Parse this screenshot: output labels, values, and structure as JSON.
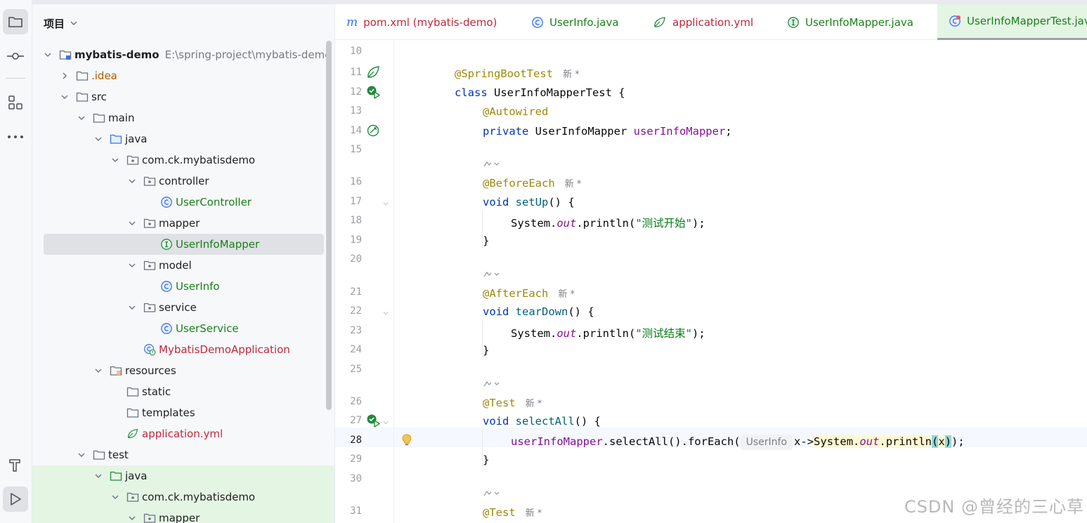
{
  "project_panel": {
    "title": "项目",
    "tree": [
      {
        "label": "mybatis-demo",
        "path": "E:\\spring-project\\mybatis-demo",
        "icon": "module-folder-icon",
        "indent": 0,
        "arrow": "down",
        "style": "bold"
      },
      {
        "label": ".idea",
        "icon": "folder-icon",
        "indent": 1,
        "arrow": "right",
        "style": "orange"
      },
      {
        "label": "src",
        "icon": "folder-icon",
        "indent": 1,
        "arrow": "down",
        "style": "normal"
      },
      {
        "label": "main",
        "icon": "folder-icon",
        "indent": 2,
        "arrow": "down",
        "style": "normal"
      },
      {
        "label": "java",
        "icon": "source-folder-icon",
        "indent": 3,
        "arrow": "down",
        "style": "normal"
      },
      {
        "label": "com.ck.mybatisdemo",
        "icon": "package-icon",
        "indent": 4,
        "arrow": "down",
        "style": "normal"
      },
      {
        "label": "controller",
        "icon": "package-icon",
        "indent": 5,
        "arrow": "down",
        "style": "normal"
      },
      {
        "label": "UserController",
        "icon": "class-icon",
        "indent": 6,
        "arrow": "none",
        "style": "green"
      },
      {
        "label": "mapper",
        "icon": "package-icon",
        "indent": 5,
        "arrow": "down",
        "style": "normal"
      },
      {
        "label": "UserInfoMapper",
        "icon": "interface-icon",
        "indent": 6,
        "arrow": "none",
        "style": "green",
        "selected": true
      },
      {
        "label": "model",
        "icon": "package-icon",
        "indent": 5,
        "arrow": "down",
        "style": "normal"
      },
      {
        "label": "UserInfo",
        "icon": "class-icon",
        "indent": 6,
        "arrow": "none",
        "style": "green"
      },
      {
        "label": "service",
        "icon": "package-icon",
        "indent": 5,
        "arrow": "down",
        "style": "normal"
      },
      {
        "label": "UserService",
        "icon": "class-icon",
        "indent": 6,
        "arrow": "none",
        "style": "green"
      },
      {
        "label": "MybatisDemoApplication",
        "icon": "spring-boot-class-icon",
        "indent": 5,
        "arrow": "none",
        "style": "red"
      },
      {
        "label": "resources",
        "icon": "resources-folder-icon",
        "indent": 3,
        "arrow": "down",
        "style": "normal"
      },
      {
        "label": "static",
        "icon": "folder-icon",
        "indent": 4,
        "arrow": "none",
        "style": "normal"
      },
      {
        "label": "templates",
        "icon": "folder-icon",
        "indent": 4,
        "arrow": "none",
        "style": "normal"
      },
      {
        "label": "application.yml",
        "icon": "spring-yaml-icon",
        "indent": 4,
        "arrow": "none",
        "style": "red"
      },
      {
        "label": "test",
        "icon": "folder-icon",
        "indent": 2,
        "arrow": "down",
        "style": "normal"
      },
      {
        "label": "java",
        "icon": "test-source-folder-icon",
        "indent": 3,
        "arrow": "down",
        "style": "normal",
        "green": true
      },
      {
        "label": "com.ck.mybatisdemo",
        "icon": "package-icon",
        "indent": 4,
        "arrow": "down",
        "style": "normal",
        "green": true
      },
      {
        "label": "mapper",
        "icon": "package-icon",
        "indent": 5,
        "arrow": "down",
        "style": "normal",
        "green": true
      }
    ]
  },
  "tabs": [
    {
      "label": "pom.xml (mybatis-demo)",
      "icon": "maven-icon",
      "color": "red"
    },
    {
      "label": "UserInfo.java",
      "icon": "class-icon",
      "color": "green"
    },
    {
      "label": "application.yml",
      "icon": "spring-yaml-icon",
      "color": "red"
    },
    {
      "label": "UserInfoMapper.java",
      "icon": "interface-icon",
      "color": "green"
    },
    {
      "label": "UserInfoMapperTest.java",
      "icon": "test-class-icon",
      "color": "green",
      "active": true
    }
  ],
  "editor": {
    "current_line": "28",
    "inlay_hint": "UserInfo",
    "author_mark": "新 *",
    "lines": [
      {
        "n": "10"
      },
      {
        "n": "11",
        "g": "spring-bean-icon"
      },
      {
        "n": "12",
        "g": "run-test-icon"
      },
      {
        "n": "13"
      },
      {
        "n": "14",
        "g": "spring-autowire-icon"
      },
      {
        "n": "15"
      },
      {
        "n": "16"
      },
      {
        "n": "17",
        "fold": true
      },
      {
        "n": "18"
      },
      {
        "n": "19"
      },
      {
        "n": "20"
      },
      {
        "n": "21"
      },
      {
        "n": "22",
        "fold": true
      },
      {
        "n": "23"
      },
      {
        "n": "24"
      },
      {
        "n": "25"
      },
      {
        "n": "26"
      },
      {
        "n": "27",
        "g": "run-test-icon",
        "fold": true
      },
      {
        "n": "28",
        "g": "lightbulb-icon"
      },
      {
        "n": "29"
      },
      {
        "n": "30"
      },
      {
        "n": "31"
      }
    ],
    "code": {
      "l11": "@SpringBootTest",
      "l12_kw": "class",
      "l12_rest": " UserInfoMapperTest {",
      "l13": "@Autowired",
      "l14_kw": "private",
      "l14_type": " UserInfoMapper ",
      "l14_field": "userInfoMapper",
      "l14_end": ";",
      "l16": "@BeforeEach",
      "l17_kw": "void",
      "l17_fn": "setUp",
      "l17_end": "() {",
      "l18_a": "System.",
      "l18_out": "out",
      "l18_b": ".println(",
      "l18_str": "\"测试开始\"",
      "l18_c": ");",
      "l19": "}",
      "l21": "@AfterEach",
      "l22_kw": "void",
      "l22_fn": "tearDown",
      "l22_end": "() {",
      "l23_a": "System.",
      "l23_out": "out",
      "l23_b": ".println(",
      "l23_str": "\"测试结束\"",
      "l23_c": ");",
      "l24": "}",
      "l26": "@Test",
      "l27_kw": "void",
      "l27_fn": "selectAll",
      "l27_end": "() {",
      "l28_field": "userInfoMapper",
      "l28_a": ".selectAll().forEach(",
      "l28_b": "x->",
      "l28_sys": "System.",
      "l28_out": "out",
      "l28_pr": ".println",
      "l28_po": "(",
      "l28_x": "x",
      "l28_pc": ")",
      "l28_end": ");",
      "l29": "}",
      "l31": "@Test"
    }
  },
  "watermark": "CSDN @曾经的三心草",
  "colors": {
    "keyword": "#0033b3",
    "annotation": "#9e880d",
    "field": "#871094",
    "function": "#00627a",
    "string": "#067d17",
    "selected_row": "#dfe1e5",
    "test_green": "#e4f5e4"
  }
}
